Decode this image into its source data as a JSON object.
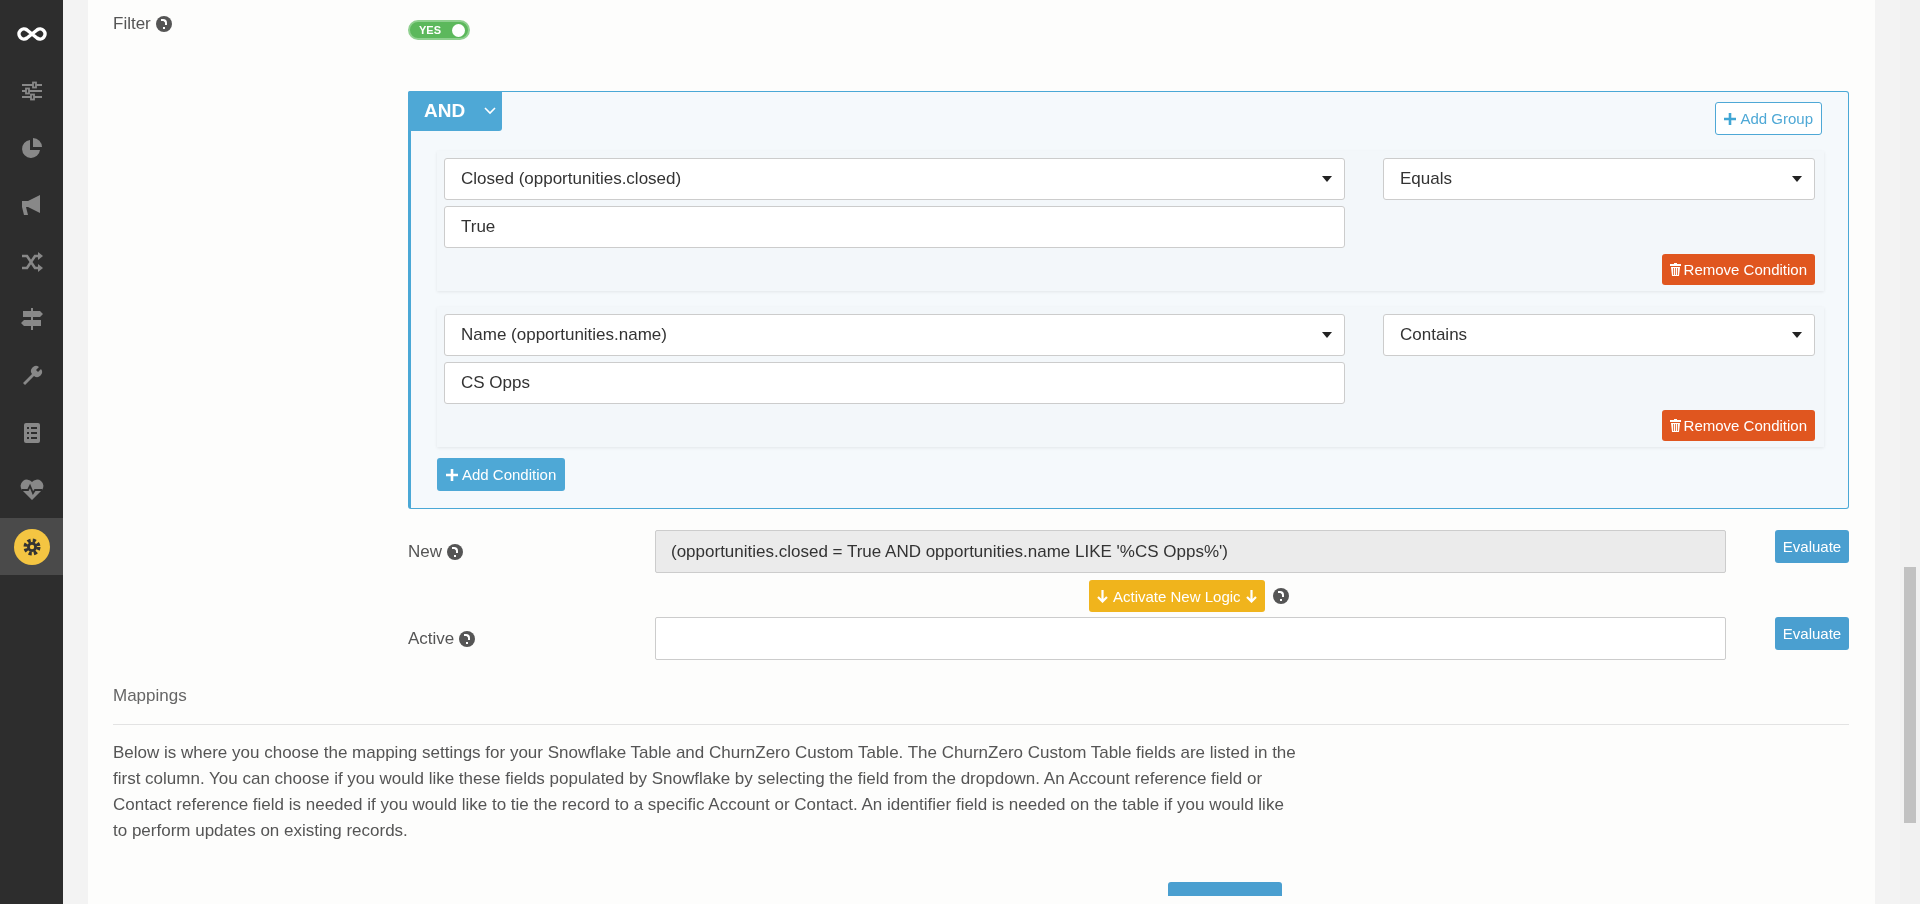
{
  "sidebar": {
    "items": [
      {
        "selected": false
      },
      {
        "selected": false
      },
      {
        "selected": false
      },
      {
        "selected": false
      },
      {
        "selected": false
      },
      {
        "selected": false
      },
      {
        "selected": false
      },
      {
        "selected": false
      },
      {
        "selected": true
      }
    ]
  },
  "filter": {
    "label": "Filter",
    "enabled": true,
    "toggle_label": "YES"
  },
  "group": {
    "operator": "AND",
    "add_group": "Add Group",
    "add_condition": "Add Condition",
    "conditions": [
      {
        "field": "Closed (opportunities.closed)",
        "operator": "Equals",
        "value": "True",
        "remove": "Remove Condition"
      },
      {
        "field": "Name (opportunities.name)",
        "operator": "Contains",
        "value": "CS Opps",
        "remove": "Remove Condition"
      }
    ]
  },
  "logic": {
    "new": {
      "label": "New",
      "value": "(opportunities.closed = True AND opportunities.name LIKE '%CS Opps%')",
      "button": "Evaluate"
    },
    "activate": "Activate New Logic",
    "active": {
      "label": "Active",
      "button": "Evaluate"
    }
  },
  "mappings": {
    "title": "Mappings",
    "description": "Below is where you choose the mapping settings for your Snowflake Table and ChurnZero Custom Table. The ChurnZero Custom Table fields are listed in the first column. You can choose if you would like these fields populated by Snowflake by selecting the field from the dropdown. An Account reference field or Contact reference field is needed if you would like to tie the record to a specific Account or Contact. An identifier field is needed on the table if you would like to perform updates on existing records."
  }
}
